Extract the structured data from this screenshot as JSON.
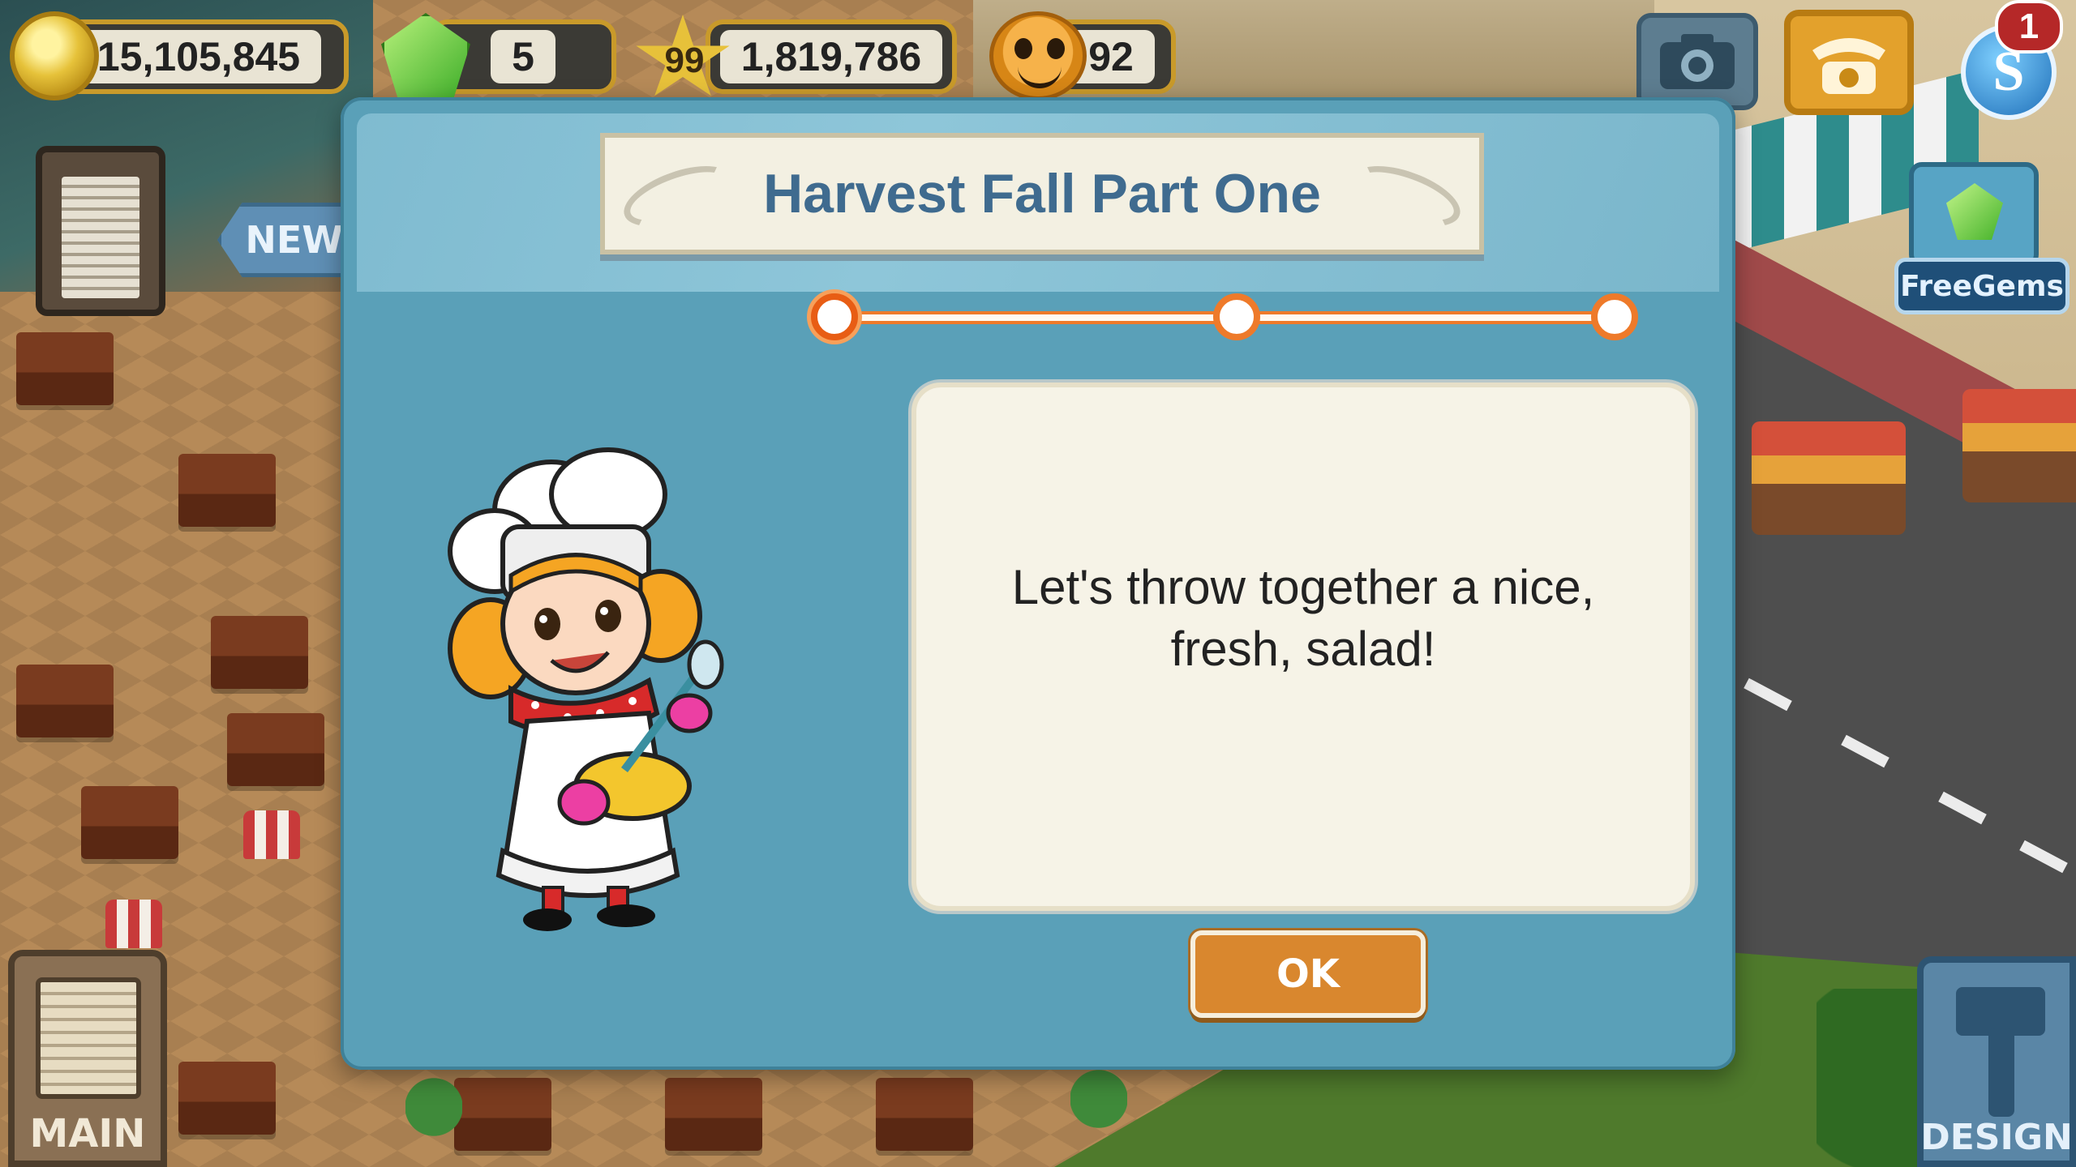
{
  "hud": {
    "coins": "15,105,845",
    "gems": "5",
    "level": "99",
    "xp": "1,819,786",
    "happiness": "92",
    "notification_count": "1",
    "free_gems_label": "FreeGems",
    "s_label": "S"
  },
  "left_panel": {
    "new_sign_label": "NEW",
    "main_label": "MAIN"
  },
  "right_panel": {
    "design_label": "DESIGN"
  },
  "dialog": {
    "title": "Harvest Fall Part One",
    "progress": {
      "total_steps": 3,
      "current_step": 1
    },
    "message": "Let's throw together a nice, fresh, salad!",
    "ok_label": "OK"
  },
  "icons": {
    "coin": "coin-icon",
    "gem": "gem-icon",
    "star": "star-icon",
    "happiness": "smiley-face-icon",
    "camera": "camera-icon",
    "phone": "telephone-icon",
    "profile": "s-currency-icon",
    "clipboard": "clipboard-icon",
    "design": "hammer-icon"
  },
  "colors": {
    "dialog_bg": "#5aa0b8",
    "title_color": "#3f6b8f",
    "progress_orange": "#ee7a2a",
    "ok_button": "#d9872e",
    "hud_border": "#c99a2a"
  }
}
